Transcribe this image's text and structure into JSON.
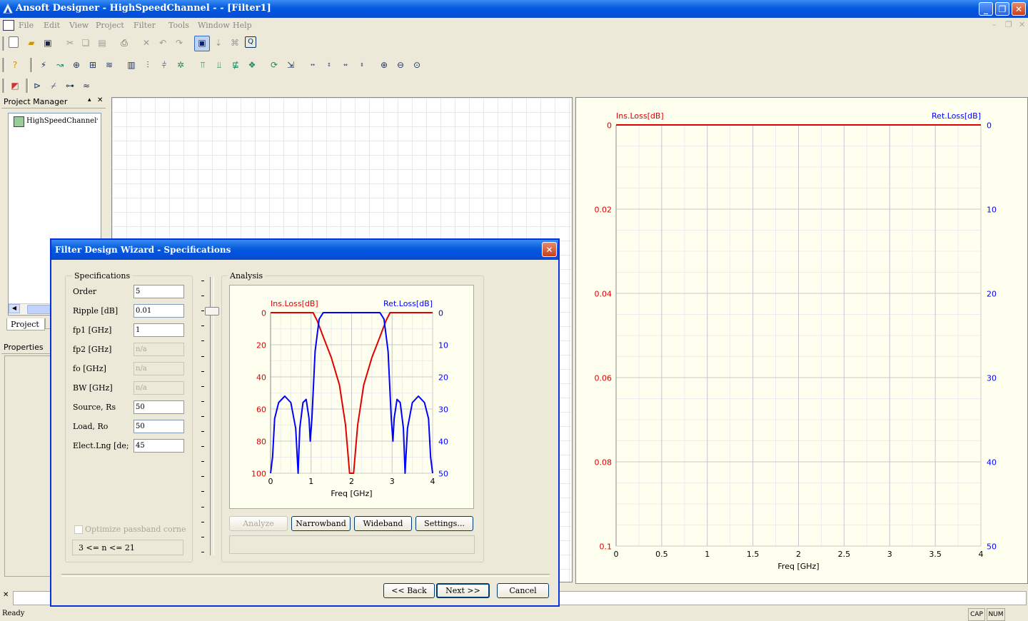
{
  "window": {
    "title": "Ansoft Designer - HighSpeedChannel -  - [Filter1]",
    "minimize": "_",
    "restore": "❐",
    "close": "✕"
  },
  "menu": [
    "File",
    "Edit",
    "View",
    "Project",
    "Filter",
    "Tools",
    "Window",
    "Help"
  ],
  "project_manager": {
    "title": "Project Manager",
    "tree_item": "HighSpeedChannel*",
    "tabs": [
      "Project"
    ]
  },
  "properties": {
    "title": "Properties"
  },
  "dialog": {
    "title": "Filter Design Wizard - Specifications",
    "spec_group": "Specifications",
    "fields": [
      {
        "label": "Order",
        "value": "5",
        "disabled": false
      },
      {
        "label": "Ripple [dB]",
        "value": "0.01",
        "disabled": false
      },
      {
        "label": "fp1 [GHz]",
        "value": "1",
        "disabled": false
      },
      {
        "label": "fp2 [GHz]",
        "value": "n/a",
        "disabled": true
      },
      {
        "label": "fo [GHz]",
        "value": "n/a",
        "disabled": true
      },
      {
        "label": "BW [GHz]",
        "value": "n/a",
        "disabled": true
      },
      {
        "label": "Source, Rs",
        "value": "50",
        "disabled": false
      },
      {
        "label": "Load, Ro",
        "value": "50",
        "disabled": false
      },
      {
        "label": "Elect.Lng [de;",
        "value": "45",
        "disabled": false
      }
    ],
    "optimize_label": "Optimize passband corne",
    "order_range": "3 <= n <= 21",
    "analysis_group": "Analysis",
    "buttons": {
      "analyze": "Analyze",
      "narrowband": "Narrowband",
      "wideband": "Wideband",
      "settings": "Settings...",
      "back": "<< Back",
      "next": "Next >>",
      "cancel": "Cancel"
    }
  },
  "status": {
    "ready": "Ready",
    "cap": "CAP",
    "num": "NUM"
  },
  "colors": {
    "ins_loss": "#e00000",
    "ret_loss": "#0000ff",
    "plot_bg": "#fffff0",
    "title_blue": "#0054e3"
  },
  "chart_data": [
    {
      "type": "line",
      "left_label": "Ins.Loss[dB]",
      "right_label": "Ret.Loss[dB]",
      "xlabel": "Freq [GHz]",
      "xlim": [
        0,
        4
      ],
      "ylim_left": [
        0,
        0.1
      ],
      "ylim_right": [
        0,
        50
      ],
      "x_ticks": [
        "0",
        "0.5",
        "1",
        "1.5",
        "2",
        "2.5",
        "3",
        "3.5",
        "4"
      ],
      "y_left_ticks": [
        "0",
        "0.02",
        "0.04",
        "0.06",
        "0.08",
        "0.1"
      ],
      "y_right_ticks": [
        "0",
        "10",
        "20",
        "30",
        "40",
        "50"
      ],
      "series": [
        {
          "name": "Ins.Loss[dB]",
          "axis": "left",
          "x": [
            0,
            4
          ],
          "y": [
            0,
            0
          ]
        }
      ]
    },
    {
      "type": "line",
      "left_label": "Ins.Loss[dB]",
      "right_label": "Ret.Loss[dB]",
      "xlabel": "Freq [GHz]",
      "xlim": [
        0,
        4
      ],
      "ylim_left": [
        0,
        100
      ],
      "ylim_right": [
        0,
        50
      ],
      "x_ticks": [
        "0",
        "1",
        "2",
        "3",
        "4"
      ],
      "y_left_ticks": [
        "0",
        "20",
        "40",
        "60",
        "80",
        "100"
      ],
      "y_right_ticks": [
        "0",
        "10",
        "20",
        "30",
        "40",
        "50"
      ],
      "series": [
        {
          "name": "Ins.Loss[dB]",
          "axis": "left",
          "x": [
            0,
            1.05,
            1.15,
            1.3,
            1.5,
            1.7,
            1.85,
            1.95,
            2.05,
            2.15,
            2.3,
            2.5,
            2.7,
            2.85,
            2.95,
            4
          ],
          "y": [
            0,
            0,
            5,
            15,
            28,
            45,
            70,
            100,
            100,
            70,
            45,
            28,
            15,
            5,
            0,
            0
          ]
        },
        {
          "name": "Ret.Loss[dB]",
          "axis": "right",
          "x": [
            0,
            0.05,
            0.1,
            0.2,
            0.35,
            0.5,
            0.62,
            0.68,
            0.72,
            0.8,
            0.88,
            0.95,
            0.98,
            1.02,
            1.1,
            1.2,
            1.3,
            1.4,
            2.6,
            2.7,
            2.8,
            2.9,
            2.98,
            3.02,
            3.05,
            3.12,
            3.2,
            3.28,
            3.32,
            3.38,
            3.5,
            3.65,
            3.8,
            3.9,
            3.95,
            4
          ],
          "y": [
            50,
            45,
            33,
            28,
            26,
            28,
            36,
            50,
            36,
            28,
            27,
            33,
            40,
            33,
            12,
            2,
            0,
            0,
            0,
            0,
            2,
            12,
            33,
            40,
            33,
            27,
            28,
            36,
            50,
            36,
            28,
            26,
            28,
            33,
            45,
            50
          ]
        }
      ]
    }
  ]
}
